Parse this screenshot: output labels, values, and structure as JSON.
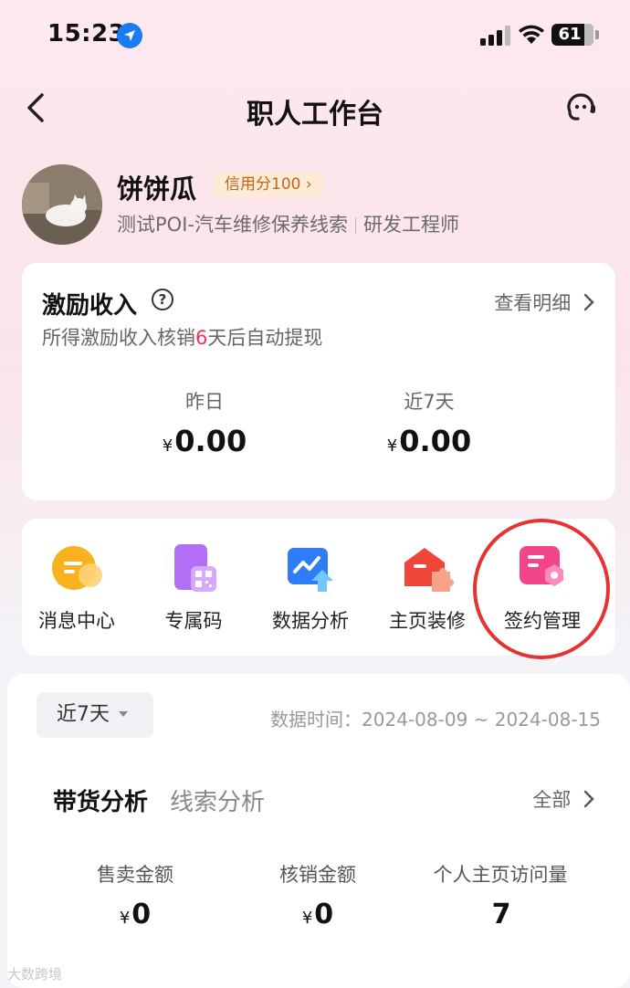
{
  "status_bar": {
    "time": "15:23",
    "battery": "61"
  },
  "nav": {
    "title": "职人工作台"
  },
  "profile": {
    "name": "饼饼瓜",
    "credit": "信用分100 ›",
    "store": "测试POI-汽车维修保养线索",
    "role": "研发工程师"
  },
  "income": {
    "title": "激励收入",
    "help": "?",
    "detail": "查看明细",
    "note_prefix": "所得激励收入核销",
    "note_days": "6",
    "note_suffix": "天后自动提现",
    "yesterday_label": "昨日",
    "yesterday_value": "0.00",
    "week_label": "近7天",
    "week_value": "0.00",
    "currency": "¥"
  },
  "tools": [
    {
      "label": "消息中心",
      "icon": "message-icon"
    },
    {
      "label": "专属码",
      "icon": "qrcode-icon"
    },
    {
      "label": "数据分析",
      "icon": "chart-icon"
    },
    {
      "label": "主页装修",
      "icon": "decoration-icon"
    },
    {
      "label": "签约管理",
      "icon": "contract-icon"
    }
  ],
  "analysis": {
    "range": "近7天",
    "data_time": "数据时间：2024-08-09 ~ 2024-08-15",
    "tab_active": "带货分析",
    "tab_inactive": "线索分析",
    "all": "全部",
    "metrics": [
      {
        "label": "售卖金额",
        "value": "0",
        "currency": "¥"
      },
      {
        "label": "核销金额",
        "value": "0",
        "currency": "¥"
      },
      {
        "label": "个人主页访问量",
        "value": "7",
        "currency": ""
      }
    ]
  },
  "watermark": "大数跨境",
  "colors": {
    "accent": "#fe2c55",
    "highlight_circle": "#e83232"
  }
}
